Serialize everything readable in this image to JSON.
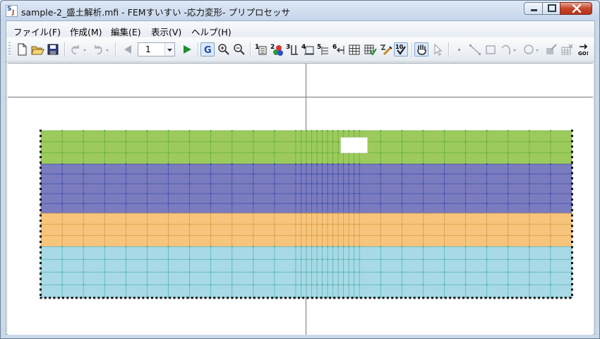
{
  "window": {
    "title": "sample-2_盛土解析.mfi - FEMすいすい -応力変形- プリプロセッサ"
  },
  "menu": {
    "items": [
      {
        "label": "ファイル(F)"
      },
      {
        "label": "作成(M)"
      },
      {
        "label": "編集(E)"
      },
      {
        "label": "表示(V)"
      },
      {
        "label": "ヘルプ(H)"
      }
    ]
  },
  "toolbar": {
    "page_number": "1",
    "tool_digits": {
      "t1": "1",
      "t2": "2",
      "t3": "3",
      "t4": "4",
      "t5": "5",
      "t6": "6",
      "t10": "10"
    },
    "g_label": "G",
    "go_label": "GO!"
  },
  "mesh": {
    "x_range": [
      0,
      100
    ],
    "coarse_spacing": 4,
    "refined_zone": [
      48,
      60
    ],
    "fine_spacing": 1,
    "opening": {
      "x": [
        56.5,
        61.5
      ],
      "y": [
        1.3,
        4.2
      ]
    },
    "layers": [
      {
        "color": "#9dca5c",
        "line_color": "#5fae3c",
        "rows": 3,
        "depth": [
          0,
          6.3
        ]
      },
      {
        "color": "#7b7bbf",
        "line_color": "#3f4fa8",
        "rows": 5,
        "depth": [
          6.3,
          15.6
        ]
      },
      {
        "color": "#f7c47b",
        "line_color": "#d69a45",
        "rows": 3,
        "depth": [
          15.6,
          21.9
        ]
      },
      {
        "color": "#a7d9e6",
        "line_color": "#4fb4a8",
        "rows": 4,
        "depth": [
          21.9,
          31.5
        ]
      }
    ],
    "border_dot_color": "#111111"
  }
}
